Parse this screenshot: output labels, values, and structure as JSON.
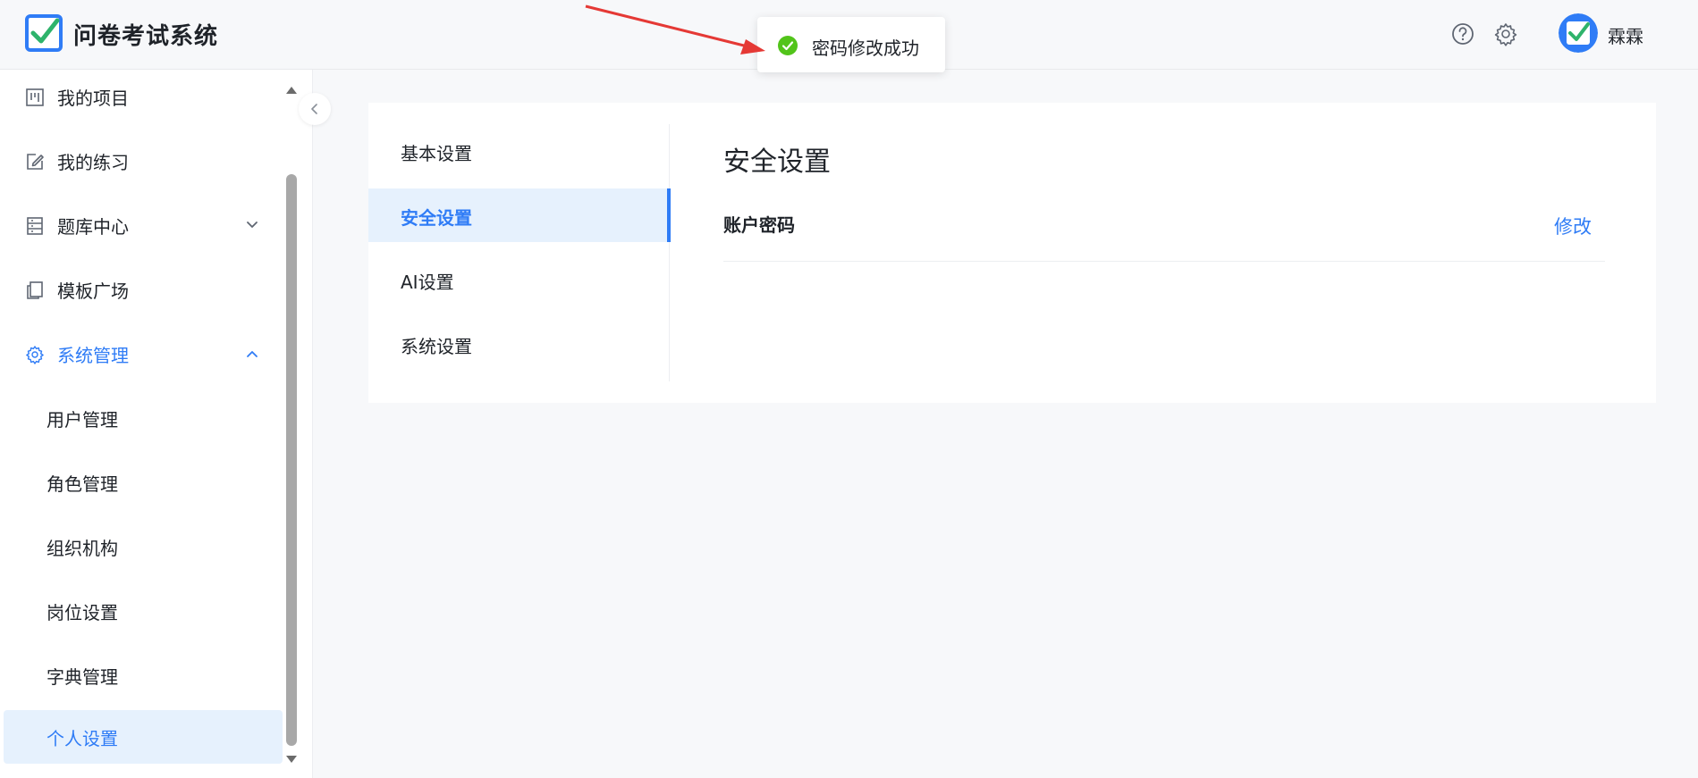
{
  "header": {
    "app_title": "问卷考试系统",
    "username": "霖霖",
    "icons": [
      "logo-icon",
      "help-icon",
      "gear-icon",
      "avatar"
    ]
  },
  "sidebar": {
    "items": [
      {
        "label": "我的项目",
        "icon": "board-icon"
      },
      {
        "label": "我的练习",
        "icon": "edit-icon"
      },
      {
        "label": "题库中心",
        "icon": "library-icon",
        "expand": "chevron-down"
      },
      {
        "label": "模板广场",
        "icon": "copy-icon"
      },
      {
        "label": "系统管理",
        "icon": "gear-icon",
        "expand": "chevron-up"
      }
    ],
    "sub_items": [
      {
        "label": "用户管理"
      },
      {
        "label": "角色管理"
      },
      {
        "label": "组织机构"
      },
      {
        "label": "岗位设置"
      },
      {
        "label": "字典管理"
      },
      {
        "label": "个人设置",
        "active": true
      }
    ]
  },
  "settings_menu": {
    "items": [
      {
        "label": "基本设置"
      },
      {
        "label": "安全设置",
        "active": true
      },
      {
        "label": "AI设置"
      },
      {
        "label": "系统设置"
      }
    ]
  },
  "security": {
    "title": "安全设置",
    "password_label": "账户密码",
    "modify_label": "修改"
  },
  "toast": {
    "message": "密码修改成功",
    "status": "success"
  },
  "colors": {
    "accent": "#2f7cf6",
    "success": "#52c41a",
    "active_bg": "#e6f1fd",
    "annotation_arrow": "#e53935"
  }
}
